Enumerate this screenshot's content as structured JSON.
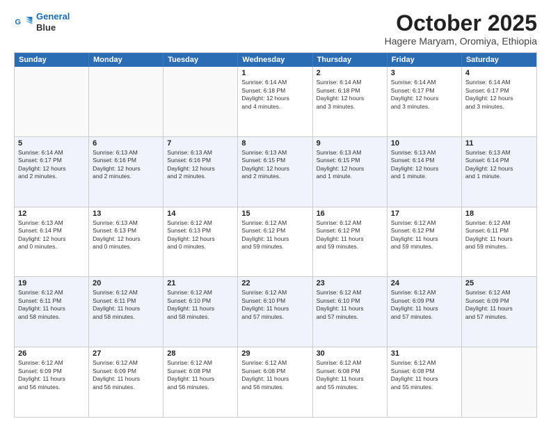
{
  "logo": {
    "line1": "General",
    "line2": "Blue"
  },
  "header": {
    "month": "October 2025",
    "location": "Hagere Maryam, Oromiya, Ethiopia"
  },
  "weekdays": [
    "Sunday",
    "Monday",
    "Tuesday",
    "Wednesday",
    "Thursday",
    "Friday",
    "Saturday"
  ],
  "rows": [
    {
      "alt": false,
      "cells": [
        {
          "day": "",
          "info": ""
        },
        {
          "day": "",
          "info": ""
        },
        {
          "day": "",
          "info": ""
        },
        {
          "day": "1",
          "info": "Sunrise: 6:14 AM\nSunset: 6:18 PM\nDaylight: 12 hours\nand 4 minutes."
        },
        {
          "day": "2",
          "info": "Sunrise: 6:14 AM\nSunset: 6:18 PM\nDaylight: 12 hours\nand 3 minutes."
        },
        {
          "day": "3",
          "info": "Sunrise: 6:14 AM\nSunset: 6:17 PM\nDaylight: 12 hours\nand 3 minutes."
        },
        {
          "day": "4",
          "info": "Sunrise: 6:14 AM\nSunset: 6:17 PM\nDaylight: 12 hours\nand 3 minutes."
        }
      ]
    },
    {
      "alt": true,
      "cells": [
        {
          "day": "5",
          "info": "Sunrise: 6:14 AM\nSunset: 6:17 PM\nDaylight: 12 hours\nand 2 minutes."
        },
        {
          "day": "6",
          "info": "Sunrise: 6:13 AM\nSunset: 6:16 PM\nDaylight: 12 hours\nand 2 minutes."
        },
        {
          "day": "7",
          "info": "Sunrise: 6:13 AM\nSunset: 6:16 PM\nDaylight: 12 hours\nand 2 minutes."
        },
        {
          "day": "8",
          "info": "Sunrise: 6:13 AM\nSunset: 6:15 PM\nDaylight: 12 hours\nand 2 minutes."
        },
        {
          "day": "9",
          "info": "Sunrise: 6:13 AM\nSunset: 6:15 PM\nDaylight: 12 hours\nand 1 minute."
        },
        {
          "day": "10",
          "info": "Sunrise: 6:13 AM\nSunset: 6:14 PM\nDaylight: 12 hours\nand 1 minute."
        },
        {
          "day": "11",
          "info": "Sunrise: 6:13 AM\nSunset: 6:14 PM\nDaylight: 12 hours\nand 1 minute."
        }
      ]
    },
    {
      "alt": false,
      "cells": [
        {
          "day": "12",
          "info": "Sunrise: 6:13 AM\nSunset: 6:14 PM\nDaylight: 12 hours\nand 0 minutes."
        },
        {
          "day": "13",
          "info": "Sunrise: 6:13 AM\nSunset: 6:13 PM\nDaylight: 12 hours\nand 0 minutes."
        },
        {
          "day": "14",
          "info": "Sunrise: 6:12 AM\nSunset: 6:13 PM\nDaylight: 12 hours\nand 0 minutes."
        },
        {
          "day": "15",
          "info": "Sunrise: 6:12 AM\nSunset: 6:12 PM\nDaylight: 11 hours\nand 59 minutes."
        },
        {
          "day": "16",
          "info": "Sunrise: 6:12 AM\nSunset: 6:12 PM\nDaylight: 11 hours\nand 59 minutes."
        },
        {
          "day": "17",
          "info": "Sunrise: 6:12 AM\nSunset: 6:12 PM\nDaylight: 11 hours\nand 59 minutes."
        },
        {
          "day": "18",
          "info": "Sunrise: 6:12 AM\nSunset: 6:11 PM\nDaylight: 11 hours\nand 59 minutes."
        }
      ]
    },
    {
      "alt": true,
      "cells": [
        {
          "day": "19",
          "info": "Sunrise: 6:12 AM\nSunset: 6:11 PM\nDaylight: 11 hours\nand 58 minutes."
        },
        {
          "day": "20",
          "info": "Sunrise: 6:12 AM\nSunset: 6:11 PM\nDaylight: 11 hours\nand 58 minutes."
        },
        {
          "day": "21",
          "info": "Sunrise: 6:12 AM\nSunset: 6:10 PM\nDaylight: 11 hours\nand 58 minutes."
        },
        {
          "day": "22",
          "info": "Sunrise: 6:12 AM\nSunset: 6:10 PM\nDaylight: 11 hours\nand 57 minutes."
        },
        {
          "day": "23",
          "info": "Sunrise: 6:12 AM\nSunset: 6:10 PM\nDaylight: 11 hours\nand 57 minutes."
        },
        {
          "day": "24",
          "info": "Sunrise: 6:12 AM\nSunset: 6:09 PM\nDaylight: 11 hours\nand 57 minutes."
        },
        {
          "day": "25",
          "info": "Sunrise: 6:12 AM\nSunset: 6:09 PM\nDaylight: 11 hours\nand 57 minutes."
        }
      ]
    },
    {
      "alt": false,
      "cells": [
        {
          "day": "26",
          "info": "Sunrise: 6:12 AM\nSunset: 6:09 PM\nDaylight: 11 hours\nand 56 minutes."
        },
        {
          "day": "27",
          "info": "Sunrise: 6:12 AM\nSunset: 6:09 PM\nDaylight: 11 hours\nand 56 minutes."
        },
        {
          "day": "28",
          "info": "Sunrise: 6:12 AM\nSunset: 6:08 PM\nDaylight: 11 hours\nand 56 minutes."
        },
        {
          "day": "29",
          "info": "Sunrise: 6:12 AM\nSunset: 6:08 PM\nDaylight: 11 hours\nand 56 minutes."
        },
        {
          "day": "30",
          "info": "Sunrise: 6:12 AM\nSunset: 6:08 PM\nDaylight: 11 hours\nand 55 minutes."
        },
        {
          "day": "31",
          "info": "Sunrise: 6:12 AM\nSunset: 6:08 PM\nDaylight: 11 hours\nand 55 minutes."
        },
        {
          "day": "",
          "info": ""
        }
      ]
    }
  ]
}
